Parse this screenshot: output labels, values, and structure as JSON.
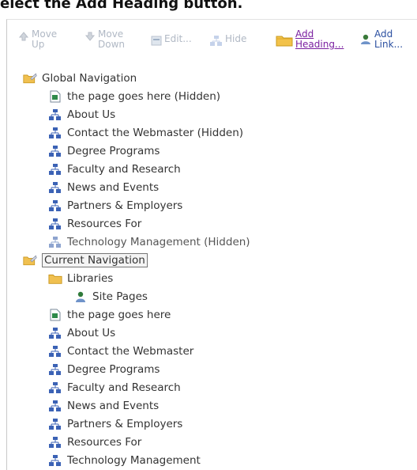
{
  "instruction": "elect the Add Heading button.",
  "toolbar": {
    "move_up": "Move\nUp",
    "move_down": "Move\nDown",
    "edit": "Edit...",
    "hide": "Hide",
    "add_heading": "Add\nHeading...",
    "add_link": "Add\nLink..."
  },
  "tree": {
    "global": {
      "label": "Global Navigation",
      "items": [
        {
          "label": "the page goes here (Hidden)",
          "icon": "page-icon",
          "muted": false
        },
        {
          "label": "About Us",
          "icon": "sitemap-icon",
          "muted": false
        },
        {
          "label": "Contact the Webmaster (Hidden)",
          "icon": "sitemap-icon",
          "muted": false
        },
        {
          "label": "Degree Programs",
          "icon": "sitemap-icon",
          "muted": false
        },
        {
          "label": "Faculty and Research",
          "icon": "sitemap-icon",
          "muted": false
        },
        {
          "label": "News and Events",
          "icon": "sitemap-icon",
          "muted": false
        },
        {
          "label": "Partners & Employers",
          "icon": "sitemap-icon",
          "muted": false
        },
        {
          "label": "Resources For",
          "icon": "sitemap-icon",
          "muted": false
        },
        {
          "label": "Technology Management (Hidden)",
          "icon": "sitemap-icon",
          "muted": true
        }
      ]
    },
    "current": {
      "label": "Current Navigation",
      "libraries_label": "Libraries",
      "site_pages_label": "Site Pages",
      "items": [
        {
          "label": "the page goes here",
          "icon": "page-icon",
          "muted": false
        },
        {
          "label": "About Us",
          "icon": "sitemap-icon",
          "muted": false
        },
        {
          "label": "Contact the Webmaster",
          "icon": "sitemap-icon",
          "muted": false
        },
        {
          "label": "Degree Programs",
          "icon": "sitemap-icon",
          "muted": false
        },
        {
          "label": "Faculty and Research",
          "icon": "sitemap-icon",
          "muted": false
        },
        {
          "label": "News and Events",
          "icon": "sitemap-icon",
          "muted": false
        },
        {
          "label": "Partners & Employers",
          "icon": "sitemap-icon",
          "muted": false
        },
        {
          "label": "Resources For",
          "icon": "sitemap-icon",
          "muted": false
        },
        {
          "label": "Technology Management",
          "icon": "sitemap-icon",
          "muted": false
        }
      ]
    }
  },
  "colors": {
    "link": "#7a1fa0",
    "disabled": "#b0b8c4",
    "text": "#333333",
    "sitemap": "#2f56a8"
  }
}
